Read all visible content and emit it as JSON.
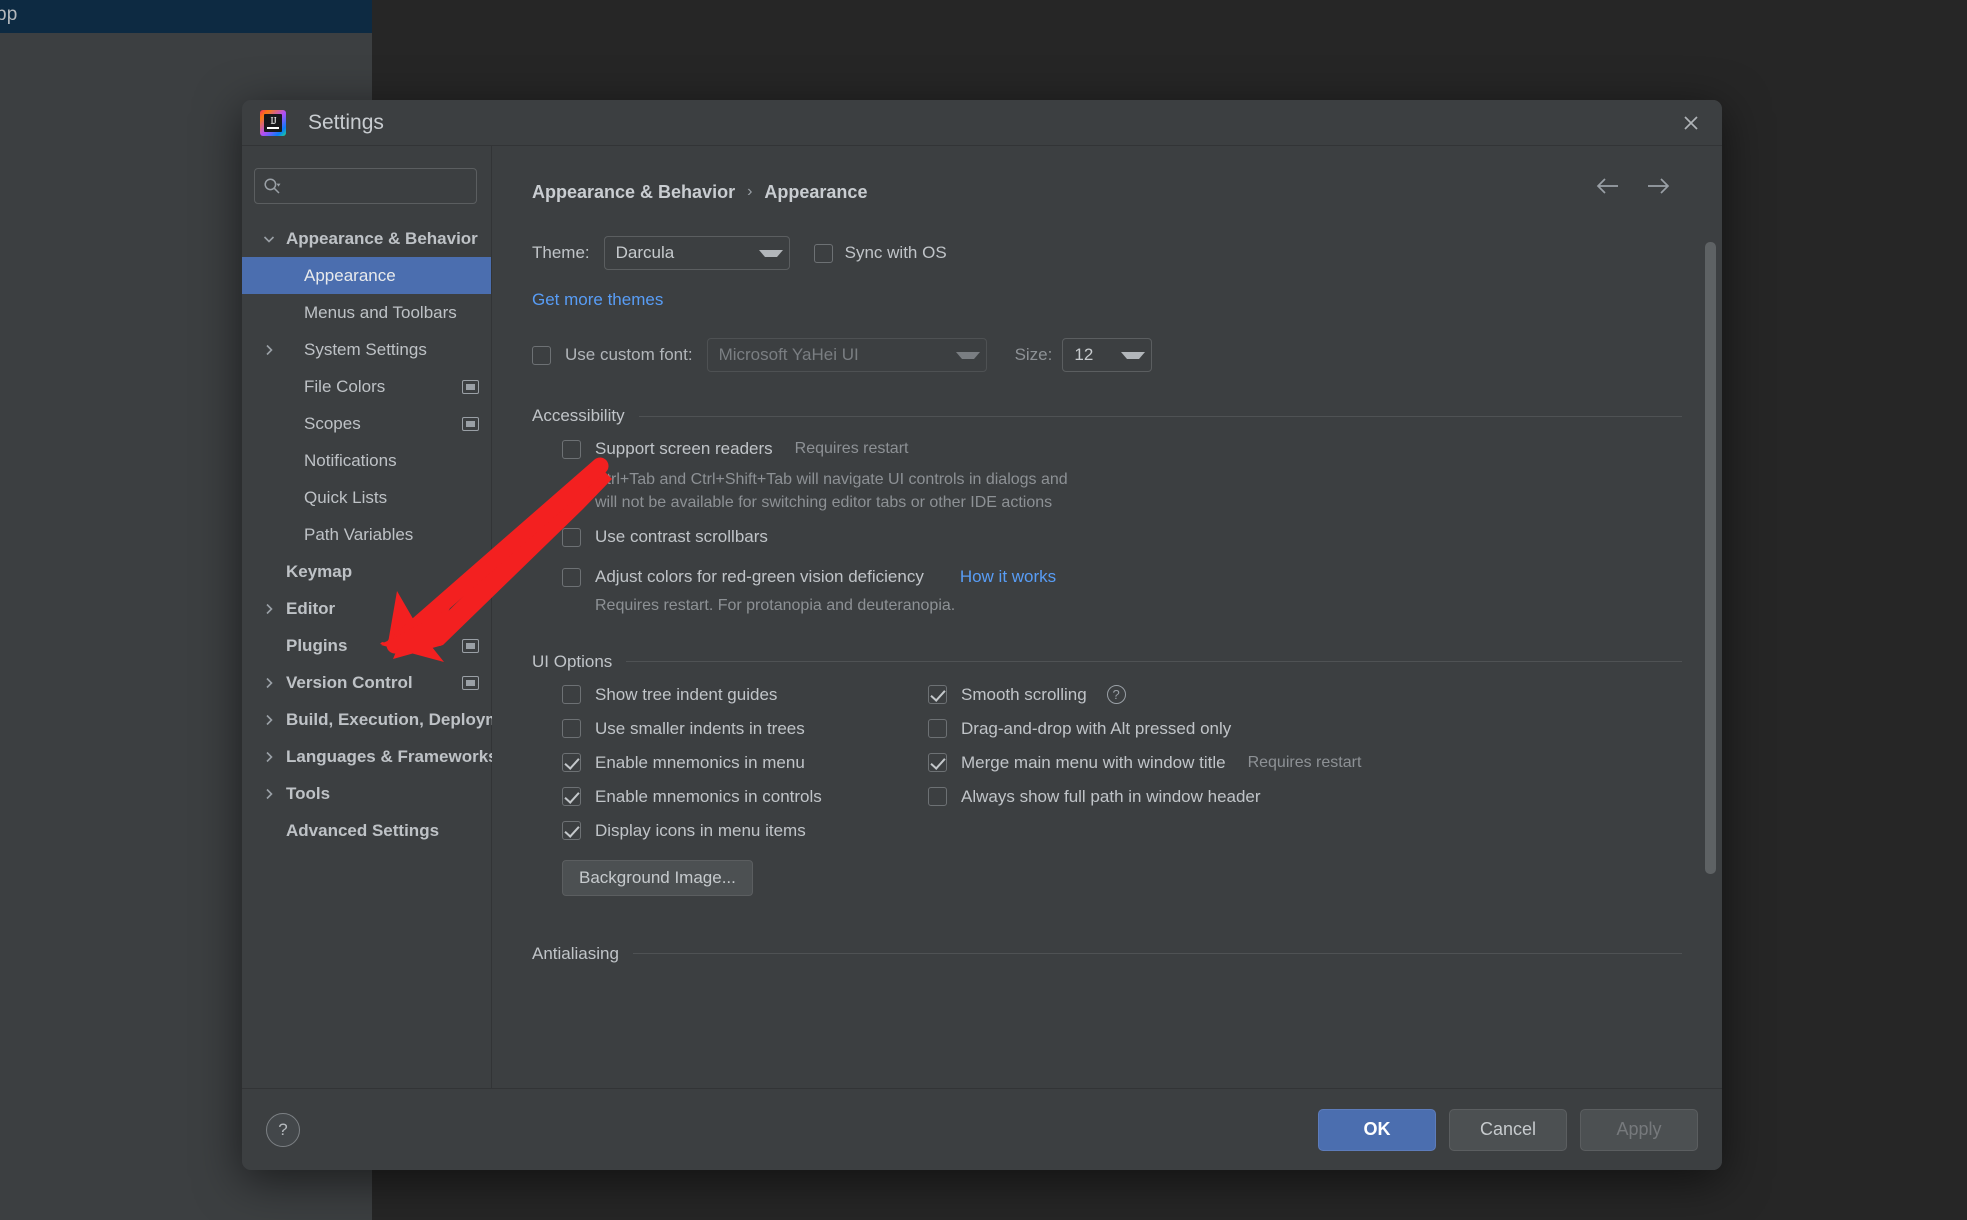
{
  "background_window": {
    "title_fragment": "pp"
  },
  "dialog": {
    "title": "Settings",
    "logo_letters": "IJ",
    "close_icon": "close-icon"
  },
  "sidebar": {
    "search": {
      "placeholder": "",
      "value": "",
      "icon": "search-icon"
    },
    "items": [
      {
        "label": "Appearance & Behavior",
        "level": 0,
        "expanded": true,
        "chevron": "chevron-down-icon",
        "selected": false,
        "bold": true,
        "trailing_icon": false
      },
      {
        "label": "Appearance",
        "level": 1,
        "chevron": null,
        "selected": true,
        "bold": false,
        "trailing_icon": false
      },
      {
        "label": "Menus and Toolbars",
        "level": 1,
        "chevron": null,
        "selected": false,
        "bold": false,
        "trailing_icon": false
      },
      {
        "label": "System Settings",
        "level": 1,
        "chevron": "chevron-right-icon",
        "selected": false,
        "bold": false,
        "trailing_icon": false
      },
      {
        "label": "File Colors",
        "level": 1,
        "chevron": null,
        "selected": false,
        "bold": false,
        "trailing_icon": true
      },
      {
        "label": "Scopes",
        "level": 1,
        "chevron": null,
        "selected": false,
        "bold": false,
        "trailing_icon": true
      },
      {
        "label": "Notifications",
        "level": 1,
        "chevron": null,
        "selected": false,
        "bold": false,
        "trailing_icon": false
      },
      {
        "label": "Quick Lists",
        "level": 1,
        "chevron": null,
        "selected": false,
        "bold": false,
        "trailing_icon": false
      },
      {
        "label": "Path Variables",
        "level": 1,
        "chevron": null,
        "selected": false,
        "bold": false,
        "trailing_icon": false
      },
      {
        "label": "Keymap",
        "level": 0,
        "chevron": null,
        "selected": false,
        "bold": true,
        "trailing_icon": false
      },
      {
        "label": "Editor",
        "level": 0,
        "chevron": "chevron-right-icon",
        "selected": false,
        "bold": true,
        "trailing_icon": false
      },
      {
        "label": "Plugins",
        "level": 0,
        "chevron": null,
        "selected": false,
        "bold": true,
        "trailing_icon": true
      },
      {
        "label": "Version Control",
        "level": 0,
        "chevron": "chevron-right-icon",
        "selected": false,
        "bold": true,
        "trailing_icon": true
      },
      {
        "label": "Build, Execution, Deployment",
        "level": 0,
        "chevron": "chevron-right-icon",
        "selected": false,
        "bold": true,
        "trailing_icon": false
      },
      {
        "label": "Languages & Frameworks",
        "level": 0,
        "chevron": "chevron-right-icon",
        "selected": false,
        "bold": true,
        "trailing_icon": false
      },
      {
        "label": "Tools",
        "level": 0,
        "chevron": "chevron-right-icon",
        "selected": false,
        "bold": true,
        "trailing_icon": false
      },
      {
        "label": "Advanced Settings",
        "level": 0,
        "chevron": null,
        "selected": false,
        "bold": true,
        "trailing_icon": false
      }
    ]
  },
  "content": {
    "breadcrumb": {
      "parent": "Appearance & Behavior",
      "separator": "›",
      "current": "Appearance"
    },
    "nav": {
      "back_icon": "arrow-left-icon",
      "forward_icon": "arrow-right-icon"
    },
    "theme": {
      "label": "Theme:",
      "value": "Darcula",
      "sync_with_os_label": "Sync with OS",
      "sync_with_os_checked": false,
      "more_themes_link": "Get more themes"
    },
    "font": {
      "use_custom_font_label": "Use custom font:",
      "use_custom_font_checked": false,
      "font_value": "Microsoft YaHei UI",
      "size_label": "Size:",
      "size_value": "12"
    },
    "accessibility": {
      "title": "Accessibility",
      "support_screen_readers_label": "Support screen readers",
      "support_screen_readers_checked": false,
      "support_screen_readers_hint": "Requires restart",
      "screen_readers_desc_line1": "Ctrl+Tab and Ctrl+Shift+Tab will navigate UI controls in dialogs and",
      "screen_readers_desc_line2": "will not be available for switching editor tabs or other IDE actions",
      "contrast_scrollbars_label": "Use contrast scrollbars",
      "contrast_scrollbars_checked": false,
      "adjust_colors_label": "Adjust colors for red-green vision deficiency",
      "adjust_colors_checked": false,
      "how_it_works_link": "How it works",
      "adjust_colors_desc": "Requires restart. For protanopia and deuteranopia."
    },
    "ui_options": {
      "title": "UI Options",
      "left": [
        {
          "label": "Show tree indent guides",
          "checked": false
        },
        {
          "label": "Use smaller indents in trees",
          "checked": false
        },
        {
          "label": "Enable mnemonics in menu",
          "checked": true
        },
        {
          "label": "Enable mnemonics in controls",
          "checked": true
        },
        {
          "label": "Display icons in menu items",
          "checked": true
        }
      ],
      "right": [
        {
          "label": "Smooth scrolling",
          "checked": true,
          "help": "?"
        },
        {
          "label": "Drag-and-drop with Alt pressed only",
          "checked": false
        },
        {
          "label": "Merge main menu with window title",
          "checked": true,
          "hint": "Requires restart"
        },
        {
          "label": "Always show full path in window header",
          "checked": false
        }
      ],
      "background_image_button": "Background Image..."
    },
    "antialiasing": {
      "title": "Antialiasing"
    }
  },
  "footer": {
    "help_label": "?",
    "ok_label": "OK",
    "cancel_label": "Cancel",
    "apply_label": "Apply"
  },
  "annotation": {
    "type": "arrow",
    "color": "#f32020",
    "points_to": "Plugins"
  }
}
